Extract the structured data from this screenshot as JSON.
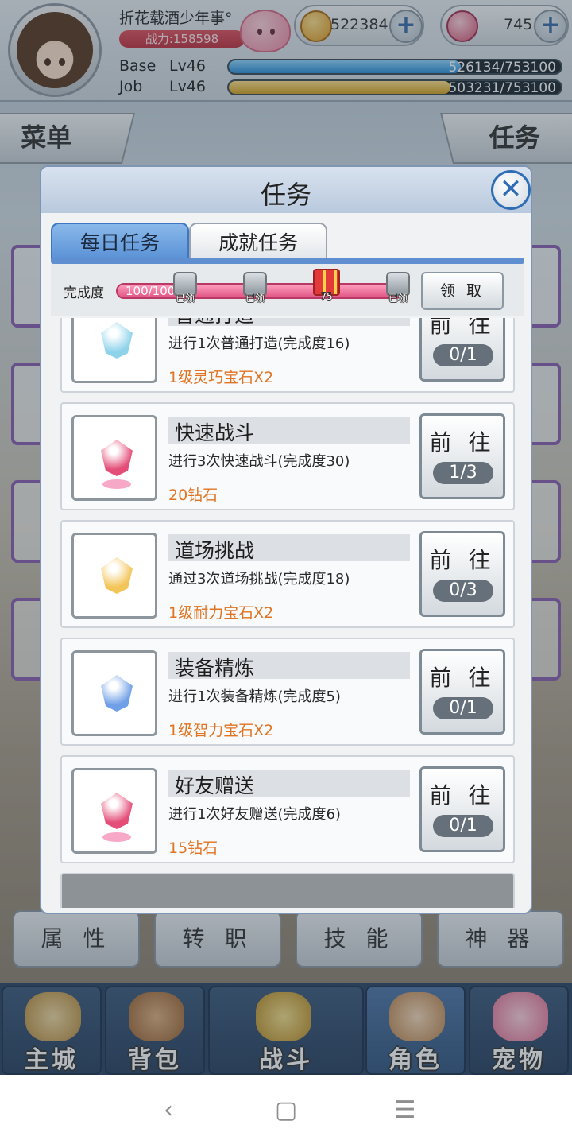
{
  "header": {
    "player_name": "折花载酒少年事°",
    "power": "战力:158598",
    "gold": "522384",
    "diamond": "745",
    "base": {
      "label": "Base",
      "level": "Lv46",
      "value": "526134/753100",
      "fraction": 0.6986
    },
    "job": {
      "label": "Job",
      "level": "Lv46",
      "value": "503231/753100",
      "fraction": 0.6682
    }
  },
  "side_tabs": {
    "menu": "菜单",
    "quest": "任务"
  },
  "modal": {
    "title": "任务",
    "tabs": [
      {
        "label": "每日任务",
        "active": true
      },
      {
        "label": "成就任务",
        "active": false
      }
    ],
    "progress": {
      "label": "完成度",
      "text": "100/100",
      "fraction": 1.0,
      "milestones": [
        {
          "tag": "已领",
          "icon": "chest-icon"
        },
        {
          "tag": "已领",
          "icon": "chest-icon"
        },
        {
          "tag": "75",
          "icon": "gift-icon"
        },
        {
          "tag": "已领",
          "icon": "chest-icon"
        }
      ],
      "claim_label": "领 取"
    },
    "tasks": [
      {
        "title": "普通打造",
        "desc": "进行1次普通打造(完成度16)",
        "reward": "1级灵巧宝石X2",
        "go_label": "前 往",
        "count": "0/1",
        "icon": "blue-gem-icon",
        "gem_color": "#8fd3ea"
      },
      {
        "title": "快速战斗",
        "desc": "进行3次快速战斗(完成度30)",
        "reward": "20钻石",
        "go_label": "前 往",
        "count": "1/3",
        "icon": "diamond-icon",
        "gem_color": "#e34d78"
      },
      {
        "title": "道场挑战",
        "desc": "通过3次道场挑战(完成度18)",
        "reward": "1级耐力宝石X2",
        "go_label": "前 往",
        "count": "0/3",
        "icon": "yellow-gem-icon",
        "gem_color": "#f3c457"
      },
      {
        "title": "装备精炼",
        "desc": "进行1次装备精炼(完成度5)",
        "reward": "1级智力宝石X2",
        "go_label": "前 往",
        "count": "0/1",
        "icon": "blue-gem-icon",
        "gem_color": "#6f9fe6"
      },
      {
        "title": "好友赠送",
        "desc": "进行1次好友赠送(完成度6)",
        "reward": "15钻石",
        "go_label": "前 往",
        "count": "0/1",
        "icon": "diamond-icon",
        "gem_color": "#e34d78"
      }
    ]
  },
  "sub_buttons": [
    "属 性",
    "转 职",
    "技 能",
    "神 器"
  ],
  "nav": [
    {
      "label": "主城",
      "active": false
    },
    {
      "label": "背包",
      "active": false
    },
    {
      "label": "战斗",
      "active": false
    },
    {
      "label": "角色",
      "active": true
    },
    {
      "label": "宠物",
      "active": false
    }
  ],
  "system_nav": {
    "back": "‹",
    "home": "▢",
    "menu": "☰"
  }
}
